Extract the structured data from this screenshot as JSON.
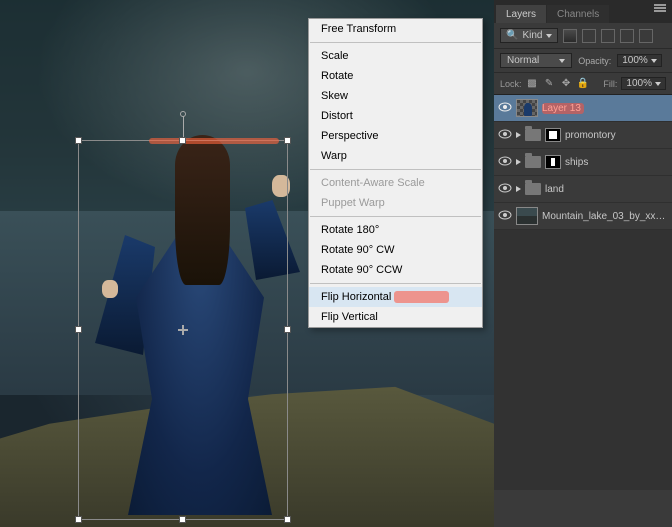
{
  "context_menu": {
    "free_transform": "Free Transform",
    "scale": "Scale",
    "rotate": "Rotate",
    "skew": "Skew",
    "distort": "Distort",
    "perspective": "Perspective",
    "warp": "Warp",
    "content_aware_scale": "Content-Aware Scale",
    "puppet_warp": "Puppet Warp",
    "rotate_180": "Rotate 180°",
    "rotate_90_cw": "Rotate 90° CW",
    "rotate_90_ccw": "Rotate 90° CCW",
    "flip_horizontal": "Flip Horizontal",
    "flip_vertical": "Flip Vertical"
  },
  "panel": {
    "tabs": {
      "layers": "Layers",
      "channels": "Channels"
    },
    "filter": {
      "kind": "Kind"
    },
    "blend": {
      "mode": "Normal",
      "opacity_label": "Opacity:",
      "opacity_value": "100%"
    },
    "lock": {
      "label": "Lock:",
      "fill_label": "Fill:",
      "fill_value": "100%"
    }
  },
  "layers": [
    {
      "name": "Layer 13",
      "type": "pixel",
      "selected": true,
      "highlight": true
    },
    {
      "name": "promontory",
      "type": "group-mask"
    },
    {
      "name": "ships",
      "type": "group-mask"
    },
    {
      "name": "land",
      "type": "group"
    },
    {
      "name": "Mountain_lake_03_by_xxM…",
      "type": "image"
    }
  ]
}
